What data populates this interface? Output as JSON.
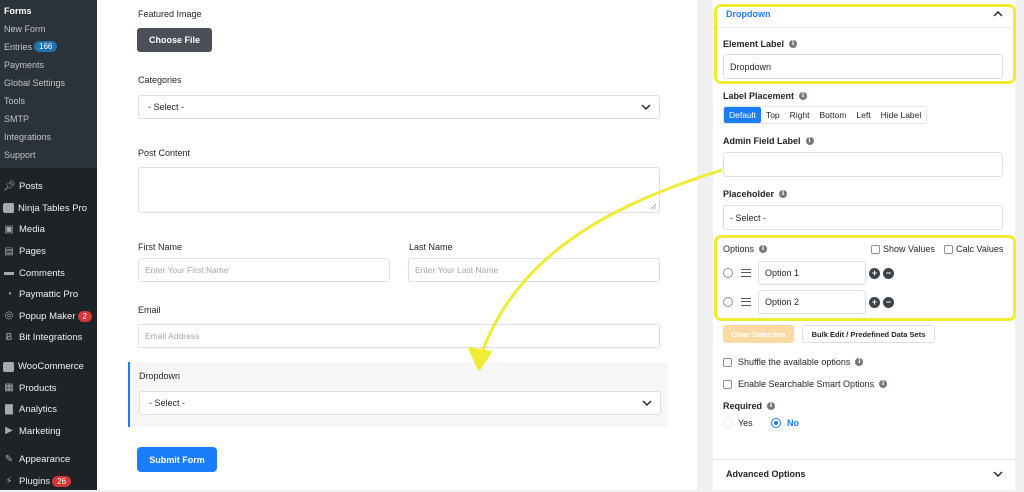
{
  "sidebar": {
    "submenu": [
      {
        "label": "Forms",
        "current": true
      },
      {
        "label": "New Form"
      },
      {
        "label": "Entries",
        "badge": "166"
      },
      {
        "label": "Payments"
      },
      {
        "label": "Global Settings"
      },
      {
        "label": "Tools"
      },
      {
        "label": "SMTP"
      },
      {
        "label": "Integrations"
      },
      {
        "label": "Support"
      }
    ],
    "menu": [
      {
        "label": "Posts",
        "icon": "pushpin-icon"
      },
      {
        "label": "Ninja Tables Pro",
        "icon": "table-icon"
      },
      {
        "label": "Media",
        "icon": "media-icon"
      },
      {
        "label": "Pages",
        "icon": "page-icon"
      },
      {
        "label": "Comments",
        "icon": "comment-icon"
      },
      {
        "label": "Paymattic Pro",
        "icon": "paymattic-icon"
      },
      {
        "label": "Popup Maker",
        "icon": "popup-icon",
        "badge": "2"
      },
      {
        "label": "Bit Integrations",
        "icon": "bit-icon"
      },
      {
        "label": "WooCommerce",
        "icon": "woocommerce-icon"
      },
      {
        "label": "Products",
        "icon": "products-icon"
      },
      {
        "label": "Analytics",
        "icon": "analytics-icon"
      },
      {
        "label": "Marketing",
        "icon": "megaphone-icon"
      },
      {
        "label": "Appearance",
        "icon": "brush-icon"
      },
      {
        "label": "Plugins",
        "icon": "plugin-icon",
        "badge": "26"
      }
    ]
  },
  "form": {
    "featured_image_label": "Featured Image",
    "choose_file_label": "Choose File",
    "categories_label": "Categories",
    "categories_value": "- Select -",
    "post_content_label": "Post Content",
    "first_name_label": "First Name",
    "first_name_placeholder": "Enter Your First Name",
    "last_name_label": "Last Name",
    "last_name_placeholder": "Enter Your Last Name",
    "email_label": "Email",
    "email_placeholder": "Email Address",
    "dropdown_label": "Dropdown",
    "dropdown_value": "- Select -",
    "submit_label": "Submit Form"
  },
  "panel": {
    "title": "Dropdown",
    "element_label_label": "Element Label",
    "element_label_value": "Dropdown",
    "label_placement_label": "Label Placement",
    "placements": [
      "Default",
      "Top",
      "Right",
      "Bottom",
      "Left",
      "Hide Label"
    ],
    "admin_field_label": "Admin Field Label",
    "admin_field_value": "",
    "placeholder_label": "Placeholder",
    "placeholder_value": "- Select -",
    "options_label": "Options",
    "show_values_label": "Show Values",
    "calc_values_label": "Calc Values",
    "options": [
      "Option 1",
      "Option 2"
    ],
    "clear_selection_label": "Clear Selection",
    "bulk_edit_label": "Bulk Edit / Predefined Data Sets",
    "shuffle_label": "Shuffle the available options",
    "searchable_label": "Enable Searchable Smart Options",
    "required_label": "Required",
    "yes_label": "Yes",
    "no_label": "No",
    "advanced_label": "Advanced Options"
  },
  "colors": {
    "accent": "#1a7efb",
    "highlight": "#f1eb34",
    "sidebar_bg": "#1d2327"
  }
}
